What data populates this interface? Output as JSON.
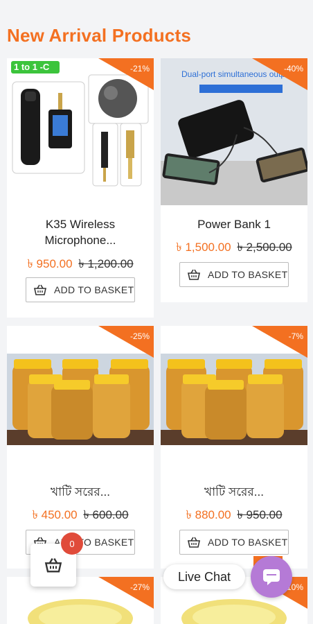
{
  "section": {
    "title": "New Arrival Products"
  },
  "products": [
    {
      "name": "K35 Wireless Microphone...",
      "discount": "-21%",
      "price": "৳ 950.00",
      "old_price": "৳ 1,200.00",
      "button": "ADD TO BASKET",
      "image_tag": "1 to 1 -C"
    },
    {
      "name": "Power Bank 1",
      "discount": "-40%",
      "price": "৳ 1,500.00",
      "old_price": "৳ 2,500.00",
      "button": "ADD TO BASKET",
      "image_caption": "Dual-port simultaneous output"
    },
    {
      "name": "খাটি সরের...",
      "discount": "-25%",
      "price": "৳ 450.00",
      "old_price": "৳ 600.00",
      "button": "ADD TO BASKET"
    },
    {
      "name": "খাটি সরের...",
      "discount": "-7%",
      "price": "৳ 880.00",
      "old_price": "৳ 950.00",
      "button": "ADD TO BASKET"
    },
    {
      "discount": "-27%"
    },
    {
      "discount": "-10%"
    }
  ],
  "cart": {
    "count": "0",
    "icon": "basket-icon"
  },
  "chat": {
    "label": "Live Chat",
    "icon": "chat-icon"
  },
  "colors": {
    "accent": "#f37021",
    "chat": "#b57ad6",
    "cart_badge": "#e04b3a"
  }
}
